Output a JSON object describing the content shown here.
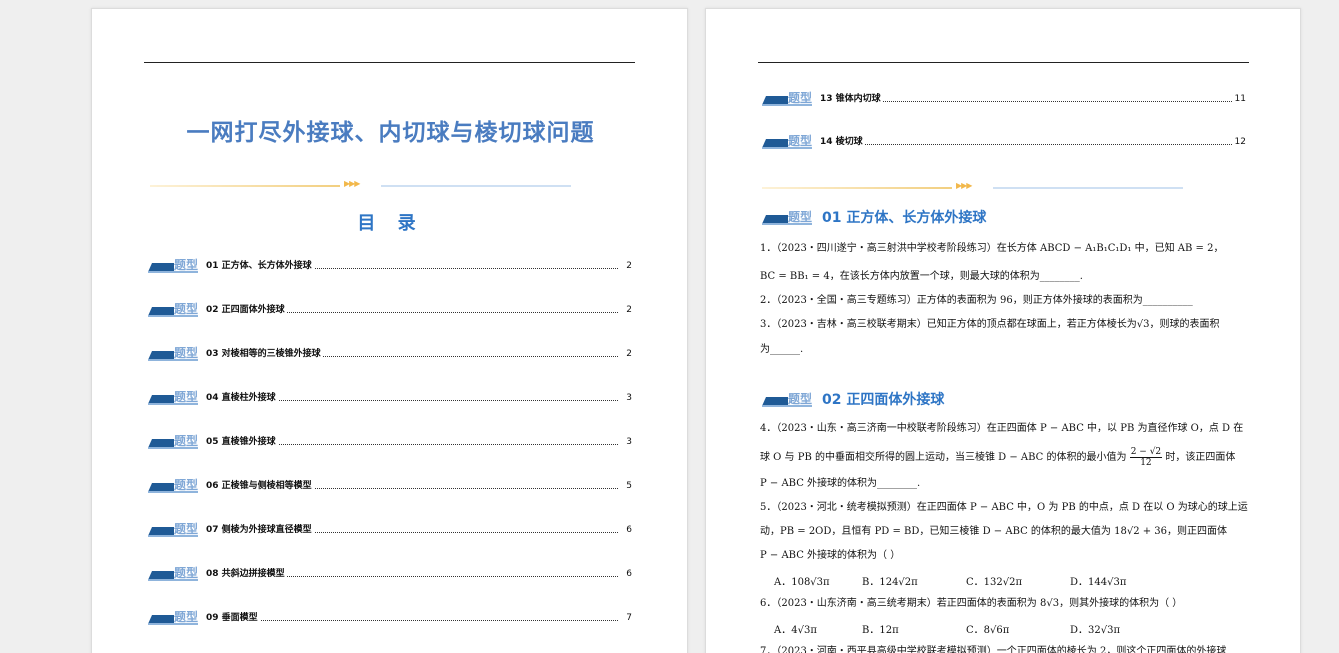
{
  "left_page": {
    "title": "一网打尽外接球、内切球与棱切球问题",
    "toc_heading": "目 录",
    "badge_text": "题型",
    "toc": [
      {
        "label": "01  正方体、长方体外接球",
        "page": "2"
      },
      {
        "label": "02  正四面体外接球",
        "page": "2"
      },
      {
        "label": "03  对棱相等的三棱锥外接球",
        "page": "2"
      },
      {
        "label": "04  直棱柱外接球",
        "page": "3"
      },
      {
        "label": "05  直棱锥外接球",
        "page": "3"
      },
      {
        "label": "06  正棱锥与侧棱相等模型",
        "page": "5"
      },
      {
        "label": "07  侧棱为外接球直径模型",
        "page": "6"
      },
      {
        "label": "08  共斜边拼接模型",
        "page": "6"
      },
      {
        "label": "09  垂面模型",
        "page": "7"
      }
    ]
  },
  "right_page": {
    "badge_text": "题型",
    "toc": [
      {
        "label": "13  锥体内切球",
        "page": "11"
      },
      {
        "label": "14  棱切球",
        "page": "12"
      }
    ],
    "sections": [
      {
        "title": "01  正方体、长方体外接球"
      },
      {
        "title": "02  正四面体外接球"
      }
    ],
    "questions": {
      "q1_line1": "1．（2023・四川遂宁・高三射洪中学校考阶段练习）在长方体 ABCD − A₁B₁C₁D₁ 中，已知 AB = 2，",
      "q1_line2": "BC = BB₁ = 4，在该长方体内放置一个球，则最大球的体积为________.",
      "q2_line1": "2．（2023・全国・高三专题练习）正方体的表面积为 96，则正方体外接球的表面积为__________",
      "q3_line1": "3．（2023・吉林・高三校联考期末）已知正方体的顶点都在球面上，若正方体棱长为√3，则球的表面积",
      "q3_line2": "为______.",
      "q4_line1": "4．（2023・山东・高三济南一中校联考阶段练习）在正四面体 P − ABC 中，以 PB 为直径作球 O，点 D 在",
      "q4_line2a": "球 O 与 PB 的中垂面相交所得的圆上运动，当三棱锥 D − ABC 的体积的最小值为",
      "q4_frac_num": "2 − √2",
      "q4_frac_den": "12",
      "q4_line2b": "时，该正四面体",
      "q4_line3": "P − ABC 外接球的体积为________.",
      "q5_line1": "5．（2023・河北・统考模拟预测）在正四面体 P − ABC 中，O 为 PB 的中点，点 D 在以 O 为球心的球上运",
      "q5_line2": "动，PB = 2OD，且恒有 PD = BD，已知三棱锥 D − ABC 的体积的最大值为 18√2 + 36，则正四面体",
      "q5_line3": "P − ABC 外接球的体积为（    ）",
      "q5_options": [
        "A．108√3π",
        "B．124√2π",
        "C．132√2π",
        "D．144√3π"
      ],
      "q6_line1": "6．（2023・山东济南・高三统考期末）若正四面体的表面积为 8√3，则其外接球的体积为（    ）",
      "q6_options": [
        "A．4√3π",
        "B．12π",
        "C．8√6π",
        "D．32√3π"
      ],
      "q7_line1": "7．（2023・河南・西平县高级中学校联考模拟预测）一个正四面体的棱长为 2，则这个正四面体的外接球"
    }
  }
}
